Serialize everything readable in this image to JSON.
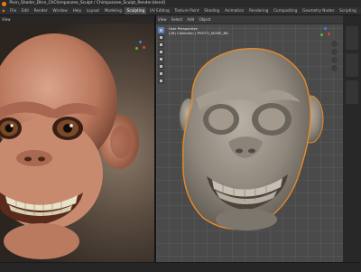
{
  "window": {
    "title": "Pixin_Shader_Dtnn_ChChimpanzee_Sculpt / Chimpanzee_Sculpt_Render.blend]"
  },
  "menubar": {
    "items": [
      "File",
      "Edit",
      "Render",
      "Window",
      "Help",
      "Layout",
      "Modeling",
      "Sculpting",
      "UV Editing",
      "Texture Paint",
      "Shading",
      "Animation",
      "Rendering",
      "Compositing",
      "Geometry Nodes",
      "Scripting"
    ]
  },
  "right_viewport": {
    "header_items": [
      "View",
      "Select",
      "Add",
      "Object"
    ],
    "info_line1": "User Perspective",
    "info_line2": "(26) Collection | PHOTO_NOISE_BG"
  },
  "colors": {
    "accent": "#e87d0d",
    "active_tool": "#5680c2",
    "gizmo_x": "#e0403a",
    "gizmo_y": "#6cb12e",
    "gizmo_z": "#3d7fe0"
  },
  "icons": [
    "blender-logo-icon",
    "navigation-gizmo-icon",
    "select-tool-icon",
    "cursor-tool-icon",
    "move-tool-icon",
    "rotate-tool-icon",
    "scale-tool-icon",
    "transform-tool-icon",
    "annotate-tool-icon",
    "measure-tool-icon",
    "zoom-icon",
    "pan-icon",
    "camera-view-icon",
    "ortho-toggle-icon"
  ]
}
